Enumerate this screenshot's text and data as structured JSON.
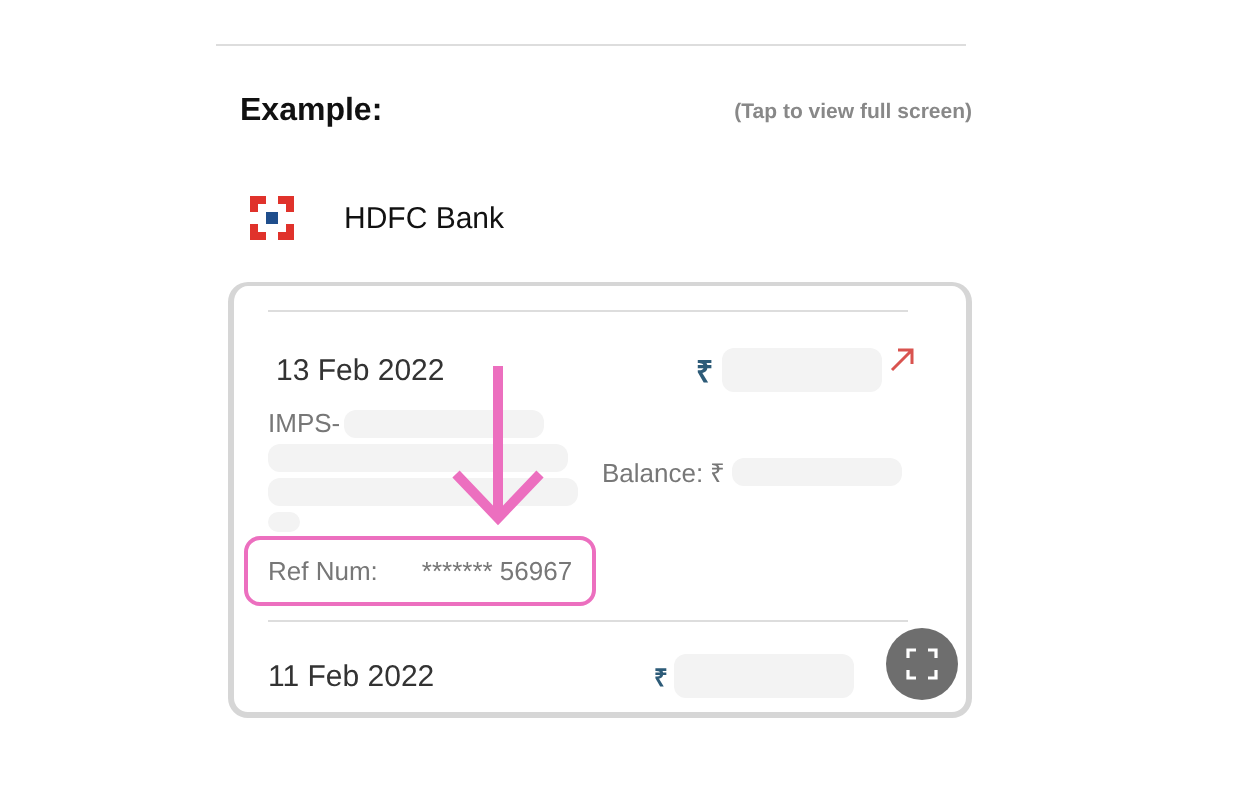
{
  "header": {
    "title": "Example:",
    "hint": "(Tap to view full screen)"
  },
  "bank": {
    "name": "HDFC Bank"
  },
  "transactions": [
    {
      "date": "13 Feb 2022",
      "currency": "₹",
      "kind": "outgoing",
      "description_prefix": "IMPS-",
      "balance_label": "Balance: ₹",
      "ref_label": "Ref Num:",
      "ref_value": "******* 56967",
      "highlighted": true
    },
    {
      "date": "11 Feb 2022",
      "currency": "₹"
    }
  ]
}
